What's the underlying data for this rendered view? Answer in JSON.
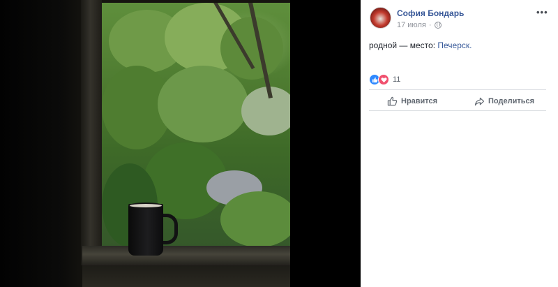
{
  "post": {
    "author": "София Бондарь",
    "date": "17 июля",
    "text_prefix": "родной — место: ",
    "location": "Печерск."
  },
  "reactions": {
    "count": "11",
    "types": [
      "like-icon",
      "love-icon"
    ]
  },
  "actions": {
    "like_label": "Нравится",
    "share_label": "Поделиться"
  },
  "menu": {
    "more_label": "•••"
  },
  "colors": {
    "link": "#385898",
    "meta": "#90949c",
    "like": "#2e89ff",
    "love": "#f0506e"
  }
}
